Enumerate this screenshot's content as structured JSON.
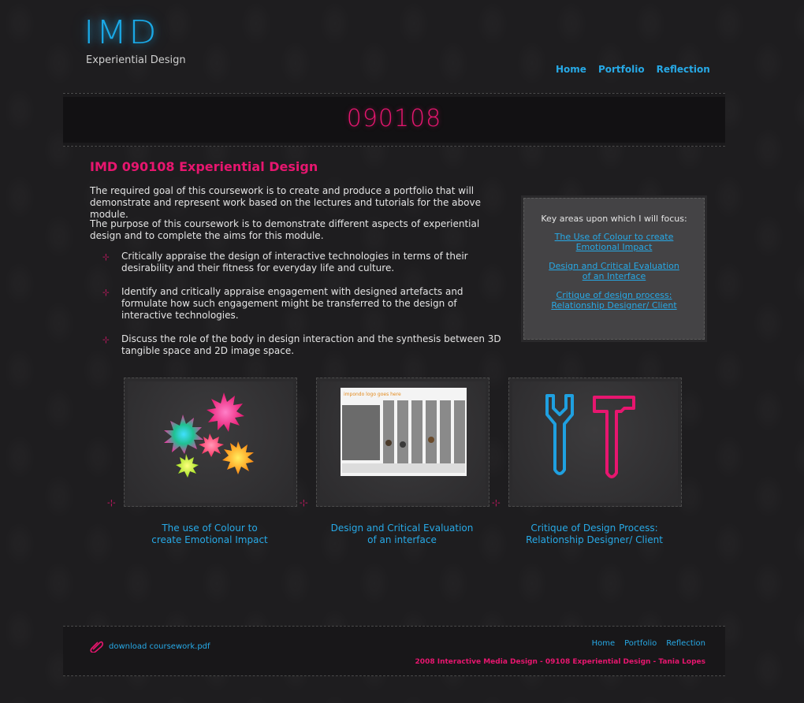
{
  "header": {
    "logo_text": "IMD",
    "logo_sub": "Experiential Design",
    "nav": [
      "Home",
      "Portfolio",
      "Reflection"
    ]
  },
  "banner": {
    "title": "090108"
  },
  "main": {
    "title": "IMD 090108 Experiential Design",
    "paragraphs": [
      "The required goal of this coursework is to create and produce a portfolio that will demonstrate and represent work based on the lectures and tutorials for the above module.",
      "The purpose of this coursework is to demonstrate different aspects of experiential design and to complete the aims for this module."
    ],
    "bullets": [
      "Critically appraise the design of interactive technologies in terms of their desirability and their fitness for everyday life and culture.",
      "Identify and critically appraise engagement with designed artefacts and formulate how such engagement might be transferred to the design of interactive technologies.",
      "Discuss the role of the body in design interaction and the synthesis between 3D tangible space and 2D image space."
    ]
  },
  "focus": {
    "heading": "Key areas upon which I will focus:",
    "links": [
      "The Use of Colour to create Emotional Impact",
      "Design and Critical Evaluation of an Interface",
      "Critique of design process: Relationship Designer/ Client"
    ]
  },
  "cards": [
    {
      "caption_line1": "The use of Colour to",
      "caption_line2": "create Emotional Impact",
      "icon": "starburst-icon"
    },
    {
      "caption_line1": "Design and Critical Evaluation",
      "caption_line2": "of an interface",
      "icon": "interface-screenshot",
      "thumb_title": "impondo logo goes here"
    },
    {
      "caption_line1": "Critique of Design Process:",
      "caption_line2": "Relationship Designer/ Client",
      "icon": "tools-icon"
    }
  ],
  "footer": {
    "download": "download coursework.pdf",
    "nav": [
      "Home",
      "Portfolio",
      "Reflection"
    ],
    "copyright": "2008 Interactive Media Design - 09108 Experiential Design - Tania Lopes"
  },
  "colors": {
    "accent_pink": "#e7166f",
    "link_blue": "#27a9e6",
    "background": "#1e1d1f"
  }
}
